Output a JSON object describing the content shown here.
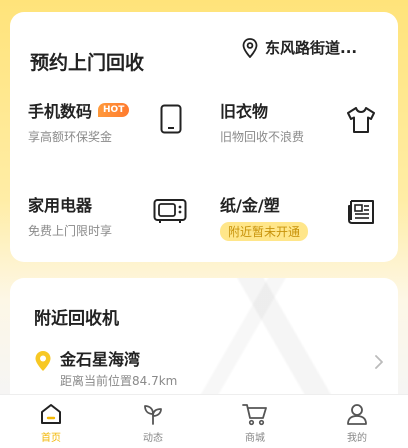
{
  "header": {
    "title": "预约上门回收",
    "location": "东风路街道..."
  },
  "services": [
    {
      "name": "手机数码",
      "badge": "HOT",
      "sub": "享高额环保奖金",
      "icon": "phone-icon"
    },
    {
      "name": "旧衣物",
      "sub": "旧物回收不浪费",
      "icon": "shirt-icon"
    },
    {
      "name": "家用电器",
      "sub": "免费上门限时享",
      "icon": "tv-icon"
    },
    {
      "name": "纸/金/塑",
      "pill": "附近暂未开通",
      "icon": "newspaper-icon"
    }
  ],
  "nearby": {
    "title": "附近回收机",
    "station": {
      "name": "金石星海湾",
      "distance": "距离当前位置84.7km"
    }
  },
  "tabs": [
    {
      "label": "首页",
      "icon": "home-icon",
      "active": true
    },
    {
      "label": "动态",
      "icon": "sprout-icon"
    },
    {
      "label": "商城",
      "icon": "cart-icon"
    },
    {
      "label": "我的",
      "icon": "user-icon"
    }
  ],
  "colors": {
    "accent": "#f2b705",
    "hot": "#ff8a36",
    "pill_bg": "#ffe68a"
  }
}
